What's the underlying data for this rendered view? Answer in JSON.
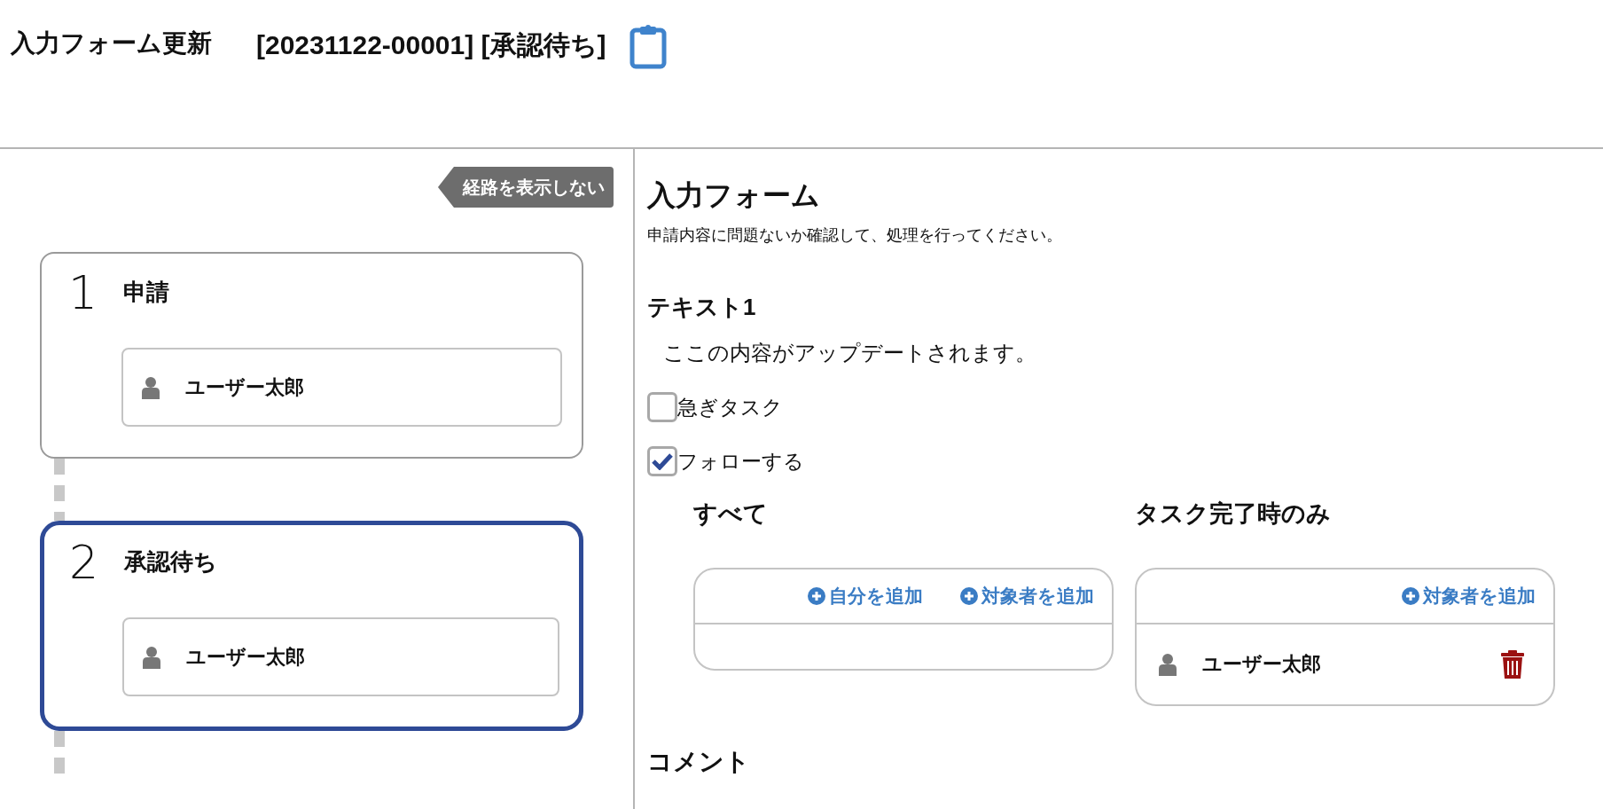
{
  "header": {
    "title": "入力フォーム更新",
    "subtitle": "[20231122-00001] [承認待ち]"
  },
  "route_toggle": {
    "label": "経路を表示しない"
  },
  "steps": [
    {
      "number": "1",
      "title": "申請",
      "assignees": [
        "ユーザー太郎"
      ],
      "selected": false
    },
    {
      "number": "2",
      "title": "承認待ち",
      "assignees": [
        "ユーザー太郎"
      ],
      "selected": true
    }
  ],
  "form": {
    "title": "入力フォーム",
    "description": "申請内容に問題ないか確認して、処理を行ってください。",
    "fields": [
      {
        "kind": "text",
        "label": "テキスト1",
        "value": "ここの内容がアップデートされます。"
      },
      {
        "kind": "checkbox",
        "label": "急ぎタスク",
        "checked": false
      },
      {
        "kind": "checkbox",
        "label": "フォローする",
        "checked": true
      }
    ],
    "follow_groups": [
      {
        "title": "すべて",
        "actions": [
          "自分を追加",
          "対象者を追加"
        ]
      },
      {
        "title": "タスク完了時のみ",
        "actions": [
          "対象者を追加"
        ],
        "members": [
          "ユーザー太郎"
        ]
      }
    ],
    "comment_label": "コメント"
  }
}
